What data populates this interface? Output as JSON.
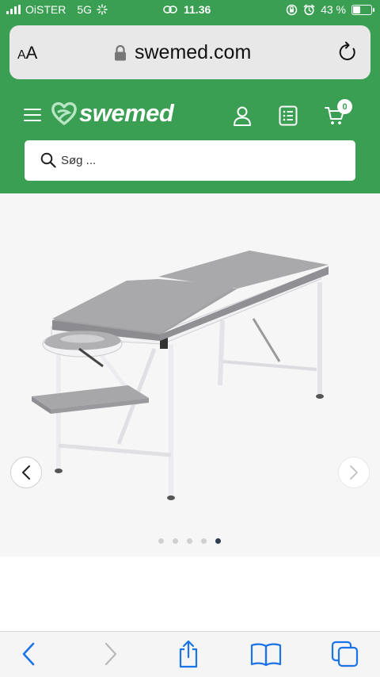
{
  "status_bar": {
    "carrier": "OiSTER",
    "network": "5G",
    "time": "11.36",
    "battery_percent": "43 %",
    "battery_level": 0.43
  },
  "browser": {
    "text_size_label_small": "A",
    "text_size_label_large": "A",
    "url": "swemed.com"
  },
  "site": {
    "logo_text": "swemed",
    "cart_count": "0",
    "search": {
      "placeholder": "Søg ...",
      "value": ""
    }
  },
  "gallery": {
    "slide_count": 5,
    "active_slide": 5
  },
  "colors": {
    "brand_green": "#3a9e53",
    "url_bar": "#e8e8e8",
    "ios_blue": "#1a73e8",
    "dot_active": "#2c3e50"
  },
  "icons": {
    "status": [
      "signal-icon",
      "hotspot-icon",
      "link-icon",
      "orientation-lock-icon",
      "alarm-icon",
      "battery-icon"
    ],
    "header": [
      "menu-icon",
      "heart-logo-icon",
      "user-icon",
      "list-icon",
      "cart-icon",
      "search-icon"
    ],
    "toolbar": [
      "back-icon",
      "forward-icon",
      "share-icon",
      "bookmarks-icon",
      "tabs-icon"
    ]
  }
}
